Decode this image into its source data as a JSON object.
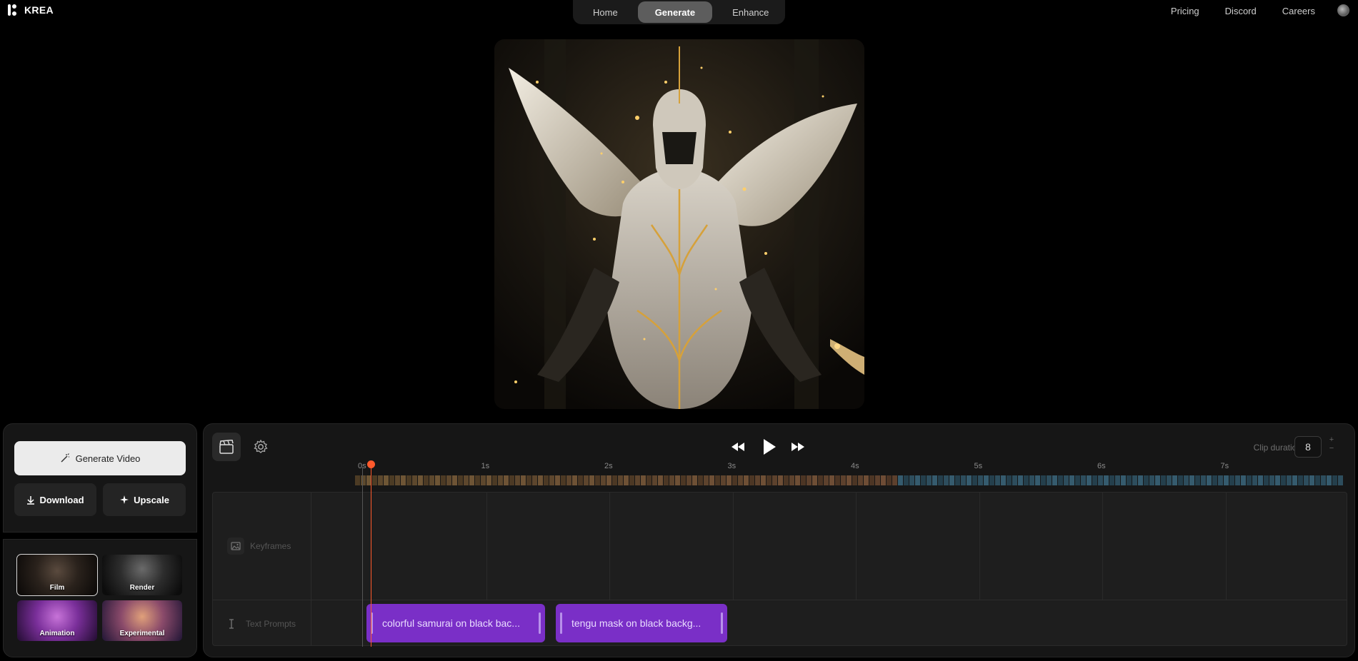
{
  "brand": {
    "name": "KREA"
  },
  "nav": {
    "tabs": [
      {
        "label": "Home",
        "active": false
      },
      {
        "label": "Generate",
        "active": true
      },
      {
        "label": "Enhance",
        "active": false
      }
    ],
    "links": [
      "Pricing",
      "Discord",
      "Careers"
    ]
  },
  "actions": {
    "generate_label": "Generate Video",
    "download_label": "Download",
    "upscale_label": "Upscale"
  },
  "styles": [
    {
      "label": "Film",
      "selected": true
    },
    {
      "label": "Render",
      "selected": false
    },
    {
      "label": "Animation",
      "selected": false
    },
    {
      "label": "Experimental",
      "selected": false
    }
  ],
  "timeline": {
    "clip_duration_label": "Clip duration",
    "clip_duration_value": "8",
    "stepper_plus": "+",
    "stepper_minus": "−",
    "ticks": [
      "0s",
      "1s",
      "2s",
      "3s",
      "4s",
      "5s",
      "6s",
      "7s"
    ],
    "playhead_seconds": 0.07,
    "tracks": {
      "keyframes_label": "Keyframes",
      "prompts_label": "Text Prompts"
    },
    "prompts": [
      {
        "text": "colorful samurai on black bac..."
      },
      {
        "text": "tengu mask on black backg..."
      }
    ]
  },
  "colors": {
    "accent_prompt": "#7a2fc7",
    "playhead": "#ff5a2c",
    "nav_active": "#5d5d5d"
  }
}
